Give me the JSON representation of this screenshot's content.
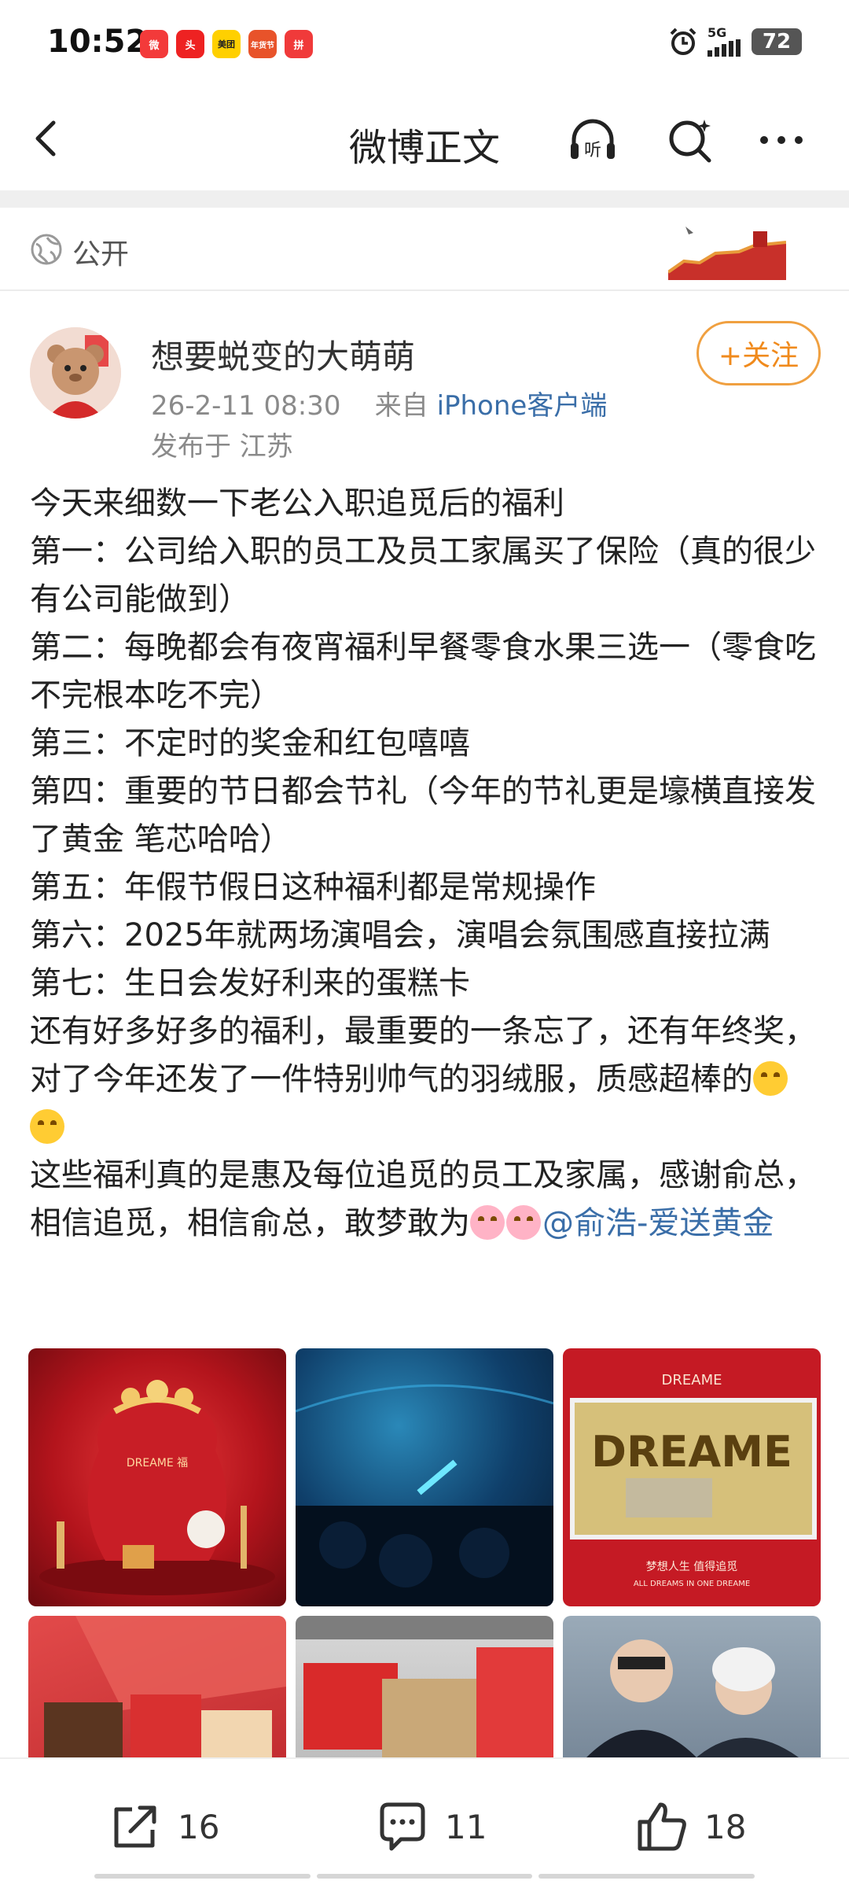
{
  "status_bar": {
    "time": "10:52",
    "apps": [
      {
        "name": "weibo-app-icon",
        "color": "#f33a3a",
        "label": "微"
      },
      {
        "name": "toutiao-app-icon",
        "color": "#ee2222",
        "label": "头"
      },
      {
        "name": "meituan-app-icon",
        "color": "#ffd000",
        "label": "美团"
      },
      {
        "name": "nianhuojie-app-icon",
        "color": "#e8532a",
        "label": "年货节"
      },
      {
        "name": "pinduoduo-app-icon",
        "color": "#f03a3a",
        "label": "拼"
      }
    ],
    "network": "5G",
    "battery": "72"
  },
  "header": {
    "title": "微博正文",
    "listen_label": "听"
  },
  "visibility": {
    "label": "公开"
  },
  "author": {
    "name": "想要蜕变的大萌萌",
    "date": "26-2-11 08:30",
    "source_prefix": "来自",
    "source": "iPhone客户端",
    "location": "发布于 江苏",
    "follow_label": "+关注"
  },
  "post": {
    "lines": [
      "今天来细数一下老公入职追觅后的福利",
      "第一：公司给入职的员工及员工家属买了保险（真的很少有公司能做到）",
      "第二：每晚都会有夜宵福利早餐零食水果三选一（零食吃不完根本吃不完）",
      "第三：不定时的奖金和红包嘻嘻",
      "第四：重要的节日都会节礼（今年的节礼更是壕横直接发了黄金 笔芯哈哈）",
      "第五：年假节假日这种福利都是常规操作",
      "第六：2025年就两场演唱会，演唱会氛围感直接拉满",
      "第七：生日会发好利来的蛋糕卡",
      "还有好多好多的福利，最重要的一条忘了，还有年终奖，对了今年还发了一件特别帅气的羽绒服，质感超棒的"
    ],
    "last_line": "这些福利真的是惠及每位追觅的员工及家属，感谢俞总，相信追觅，相信俞总，敢梦敢为",
    "mention": "@俞浩-爱送黄金"
  },
  "photos": {
    "p1_text": "DREAME 福",
    "p3_brand": "DREAME",
    "p3_card": "DREAME",
    "p3_slogan": "梦想人生  值得追觅",
    "p3_slogan_en": "ALL DREAMS IN ONE DREAME"
  },
  "actions": {
    "repost_count": "16",
    "comment_count": "11",
    "like_count": "18"
  },
  "colors": {
    "accent_orange": "#f08a1c",
    "link_blue": "#3a6ea8"
  }
}
